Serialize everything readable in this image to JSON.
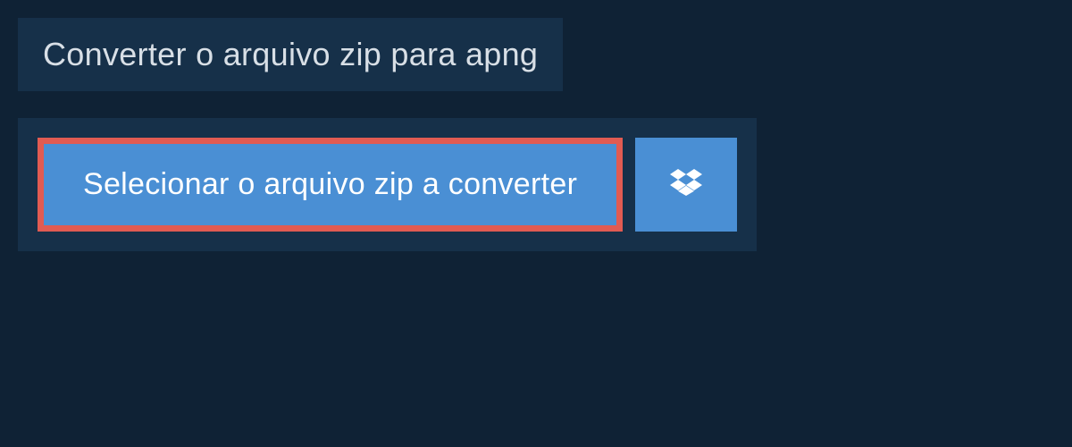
{
  "header": {
    "title": "Converter o arquivo zip para apng"
  },
  "upload": {
    "select_label": "Selecionar o arquivo zip a converter"
  }
}
